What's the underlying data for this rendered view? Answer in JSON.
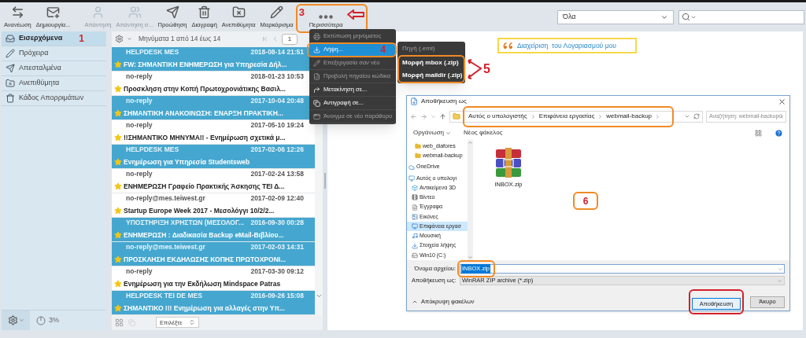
{
  "toolbar": {
    "buttons": [
      {
        "label": "Ανανέωση",
        "disabled": false
      },
      {
        "label": "Δημιουργία...",
        "disabled": false
      },
      {
        "label": "Απάντηση",
        "disabled": true
      },
      {
        "label": "Απάντηση σ...",
        "disabled": true
      },
      {
        "label": "Προώθηση",
        "disabled": false
      },
      {
        "label": "Διαγραφή",
        "disabled": false
      },
      {
        "label": "Ανεπιθύμητα",
        "disabled": false
      },
      {
        "label": "Μαρκάρισμα",
        "disabled": false
      },
      {
        "label": "Περισσότερα",
        "disabled": false,
        "annotation": "3"
      }
    ],
    "filter": {
      "value": "Όλα"
    }
  },
  "sidebar": {
    "folders": [
      {
        "label": "Εισερχόμενα",
        "selected": true,
        "annotation": "1"
      },
      {
        "label": "Πρόχειρα",
        "selected": false
      },
      {
        "label": "Απεσταλμένα",
        "selected": false
      },
      {
        "label": "Ανεπιθύμητα",
        "selected": false
      },
      {
        "label": "Κάδος Απορριμάτων",
        "selected": false
      }
    ],
    "quota": "3%"
  },
  "message_list": {
    "header": "Μηνύματα 1 από 14 έως 14",
    "page": "1",
    "messages": [
      {
        "from": "HELPDESK MES",
        "date": "2018-08-14 21:51",
        "subject": "FW: ΣΗΜΑΝΤΙΚΗ ΕΝΗΜΕΡΩΣΗ για Υπηρεσία Δήλ...",
        "selected": true
      },
      {
        "from": "no-reply",
        "date": "2018-01-23 10:53",
        "subject": "Προσκληση στην Κοπή Πρωτοχρονιάτικης Βασιλ...",
        "selected": false
      },
      {
        "from": "no-reply",
        "date": "2017-10-04 20:48",
        "subject": "ΣΗΜΑΝΤΙΚΗ ΑΝΑΚΟΙΝΩΣΗ: ΕΝΑΡΞΗ ΠΡΑΚΤΙΚΗ...",
        "selected": true
      },
      {
        "from": "no-reply",
        "date": "2017-05-10 19:24",
        "subject": "!!ΣΗΜΑΝΤΙΚΟ ΜΗΝΥΜΑ!! - Ενημέρωση σχετικά μ...",
        "selected": false
      },
      {
        "from": "HELPDESK MES",
        "date": "2017-02-06 12:26",
        "subject": "Ενημέρωση για Υπηρεσία Studentsweb",
        "selected": true
      },
      {
        "from": "no-reply",
        "date": "2017-02-24 13:58",
        "subject": "ΕΝΗΜΕΡΩΣΗ Γραφείο Πρακτικής Άσκησης ΤΕΙ Δ...",
        "selected": false
      },
      {
        "from": "no-reply@mes.teiwest.gr",
        "date": "2017-02-09 12:40",
        "subject": "Startup Europe Week 2017 - Μεσολόγγι 10/2/2...",
        "selected": false
      },
      {
        "from": "ΥΠΟΣΤΗΡΙΞΗ ΧΡΗΣΤΩΝ (ΜΕΣΟΛΟΓ...",
        "date": "2016-09-30 00:28",
        "subject": "ΕΝΗΜΕΡΩΣΗ : Διαδικασία Backup eMail-Βιβλίου...",
        "selected": true
      },
      {
        "from": "no-reply@mes.teiwest.gr",
        "date": "2017-02-03 14:31",
        "subject": "ΠΡΟΣΚΛΗΣΗ ΕΚΔΗΛΩΣΗΣ ΚΟΠΗΣ ΠΡΩΤΟΧΡΟΝΙ...",
        "selected": true
      },
      {
        "from": "no-reply",
        "date": "2017-03-30 09:12",
        "subject": "Ενημέρωση για την Εκδήλωση Mindspace Patras",
        "selected": false
      },
      {
        "from": "HELPDESK TEI DE MES",
        "date": "2016-09-26 15:08",
        "subject": "ΣΗΜΑΝΤΙΚΟ !!! Ενημέρωση για αλλαγές στην Υπ...",
        "selected": true
      }
    ],
    "footer_select": "Επιλέξτε"
  },
  "more_menu": {
    "items": [
      {
        "label": "Εκτύπωση μηνύματος",
        "disabled": true,
        "selected": false
      },
      {
        "label": "Λήψη...",
        "disabled": false,
        "selected": true,
        "annotation": "4"
      },
      {
        "label": "Επεξεργασία σαν νέο",
        "disabled": true,
        "selected": false
      },
      {
        "label": "Προβολή πηγαίου κώδικα",
        "disabled": true,
        "selected": false
      },
      {
        "label": "Μετακίνηση σε...",
        "disabled": false,
        "selected": false
      },
      {
        "label": "Αντιγραφή σε...",
        "disabled": false,
        "selected": false
      },
      {
        "label": "Άνοιγμα σε νέο παράθυρο",
        "disabled": true,
        "selected": false
      }
    ]
  },
  "download_submenu": {
    "annotation": "5",
    "items": [
      {
        "label": "Πηγή (.eml)",
        "disabled": true
      },
      {
        "label": "Μορφή mbox (.zip)",
        "disabled": false
      },
      {
        "label": "Μορφή maildir (.zip)",
        "disabled": false
      }
    ]
  },
  "preview": {
    "account_link": "Διαχείριση  του Λογαριασμού μου"
  },
  "save_dialog": {
    "title": "Αποθήκευση ως",
    "path": [
      "Αυτός ο υπολογιστής",
      "Επιφάνεια εργασίας",
      "webmail-backup"
    ],
    "search_placeholder": "Αναζήτηση: webmail-backup",
    "organize": "Οργάνωση",
    "new_folder": "Νέος φάκελος",
    "nav_items": [
      {
        "label": "web_diafores",
        "kind": "folder",
        "selected": false
      },
      {
        "label": "webmail-backup",
        "kind": "folder",
        "selected": false
      },
      {
        "label": "OneDrive",
        "kind": "cloud",
        "selected": false
      },
      {
        "label": "Αυτός ο υπολογι",
        "kind": "pc",
        "selected": false
      },
      {
        "label": "Αντικείμενα 3D",
        "kind": "cube",
        "selected": false
      },
      {
        "label": "Βίντεο",
        "kind": "video",
        "selected": false
      },
      {
        "label": "Έγγραφα",
        "kind": "document",
        "selected": false
      },
      {
        "label": "Εικόνες",
        "kind": "pictures",
        "selected": false
      },
      {
        "label": "Επιφάνεια εργασ",
        "kind": "desktop",
        "selected": true
      },
      {
        "label": "Μουσική",
        "kind": "music",
        "selected": false
      },
      {
        "label": "Στοιχεία λήψης",
        "kind": "download",
        "selected": false
      },
      {
        "label": "Win10 (C:)",
        "kind": "drive",
        "selected": false
      }
    ],
    "files": [
      {
        "name": "INBOX.zip"
      }
    ],
    "annotation": "6",
    "filename_label": "Όνομα αρχείου:",
    "filename": "INBOX.zip",
    "save_type_label": "Αποθήκευση ως:",
    "save_type": "WinRAR ZIP archive (*.zip)",
    "hide_folders": "Απόκρυψη φακέλων",
    "buttons": [
      "Αποθήκευση",
      "Άκυρο"
    ]
  }
}
